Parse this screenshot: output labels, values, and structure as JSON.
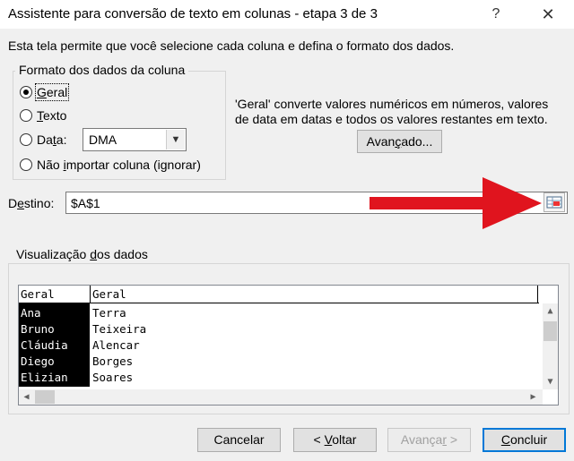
{
  "window": {
    "title": "Assistente para conversão de texto em colunas - etapa 3 de 3",
    "help_label": "?",
    "close_label": "✕"
  },
  "intro_text": "Esta tela permite que você selecione cada coluna e defina o formato dos dados.",
  "column_format": {
    "group_title": "Formato dos dados da coluna",
    "options": [
      {
        "label": "Geral",
        "mnemonic": "G",
        "rest": "eral",
        "checked": true
      },
      {
        "label": "Texto",
        "mnemonic": "T",
        "rest": "exto",
        "checked": false
      },
      {
        "label": "Data:",
        "pre": "Da",
        "mnemonic": "t",
        "rest": "a:",
        "checked": false
      },
      {
        "label": "Não importar coluna (ignorar)",
        "pre": "Não ",
        "mnemonic": "i",
        "rest": "mportar coluna (ignorar)",
        "checked": false
      }
    ],
    "date_select_value": "DMA"
  },
  "description": {
    "line1": "'Geral' converte valores numéricos em números, valores",
    "line2": "de data em datas e todos os valores restantes em texto."
  },
  "advanced_button": {
    "pre": "Avan",
    "mnemonic": "ç",
    "rest": "ado..."
  },
  "destination": {
    "label_pre": "D",
    "label_mnemonic": "e",
    "label_rest": "stino:",
    "value": "$A$1",
    "collapse_icon": "range-selector-icon"
  },
  "arrow_color": "#e0141e",
  "preview": {
    "group_title_pre": "Visualização ",
    "group_title_mnemonic": "d",
    "group_title_rest": "os dados",
    "headers": [
      "Geral",
      "Geral"
    ],
    "rows": [
      [
        "Ana",
        "Terra"
      ],
      [
        "Bruno",
        "Teixeira"
      ],
      [
        "Cláudia",
        "Alencar"
      ],
      [
        "Diego",
        "Borges"
      ],
      [
        "Elizian",
        "Soares"
      ]
    ]
  },
  "buttons": {
    "cancel": "Cancelar",
    "back_pre": "< ",
    "back_mnemonic": "V",
    "back_rest": "oltar",
    "next_pre": "Avança",
    "next_mnemonic": "r",
    "next_rest": " >",
    "finish_pre": "",
    "finish_mnemonic": "C",
    "finish_rest": "oncluir"
  }
}
